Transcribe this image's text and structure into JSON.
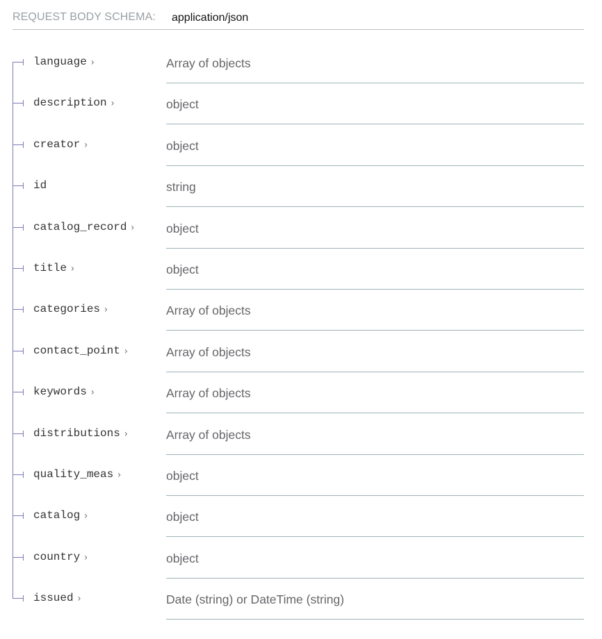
{
  "header": {
    "label": "Request Body schema:",
    "value": "application/json"
  },
  "colors": {
    "tree_line": "#7b7bb8",
    "divider": "#9fb2b8",
    "header_divider": "#bcbcbc"
  },
  "fields": [
    {
      "name": "language",
      "type": "Array of objects",
      "expandable": true
    },
    {
      "name": "description",
      "type": "object",
      "expandable": true
    },
    {
      "name": "creator",
      "type": "object",
      "expandable": true
    },
    {
      "name": "id",
      "type": "string",
      "expandable": false
    },
    {
      "name": "catalog_record",
      "type": "object",
      "expandable": true
    },
    {
      "name": "title",
      "type": "object",
      "expandable": true
    },
    {
      "name": "categories",
      "type": "Array of objects",
      "expandable": true
    },
    {
      "name": "contact_point",
      "type": "Array of objects",
      "expandable": true
    },
    {
      "name": "keywords",
      "type": "Array of objects",
      "expandable": true
    },
    {
      "name": "distributions",
      "type": "Array of objects",
      "expandable": true
    },
    {
      "name": "quality_meas",
      "type": "object",
      "expandable": true
    },
    {
      "name": "catalog",
      "type": "object",
      "expandable": true
    },
    {
      "name": "country",
      "type": "object",
      "expandable": true
    },
    {
      "name": "issued",
      "type": "Date (string) or DateTime (string)",
      "expandable": true
    }
  ],
  "icons": {
    "expand": "chevron-right-icon",
    "chevron_glyph": "›"
  }
}
